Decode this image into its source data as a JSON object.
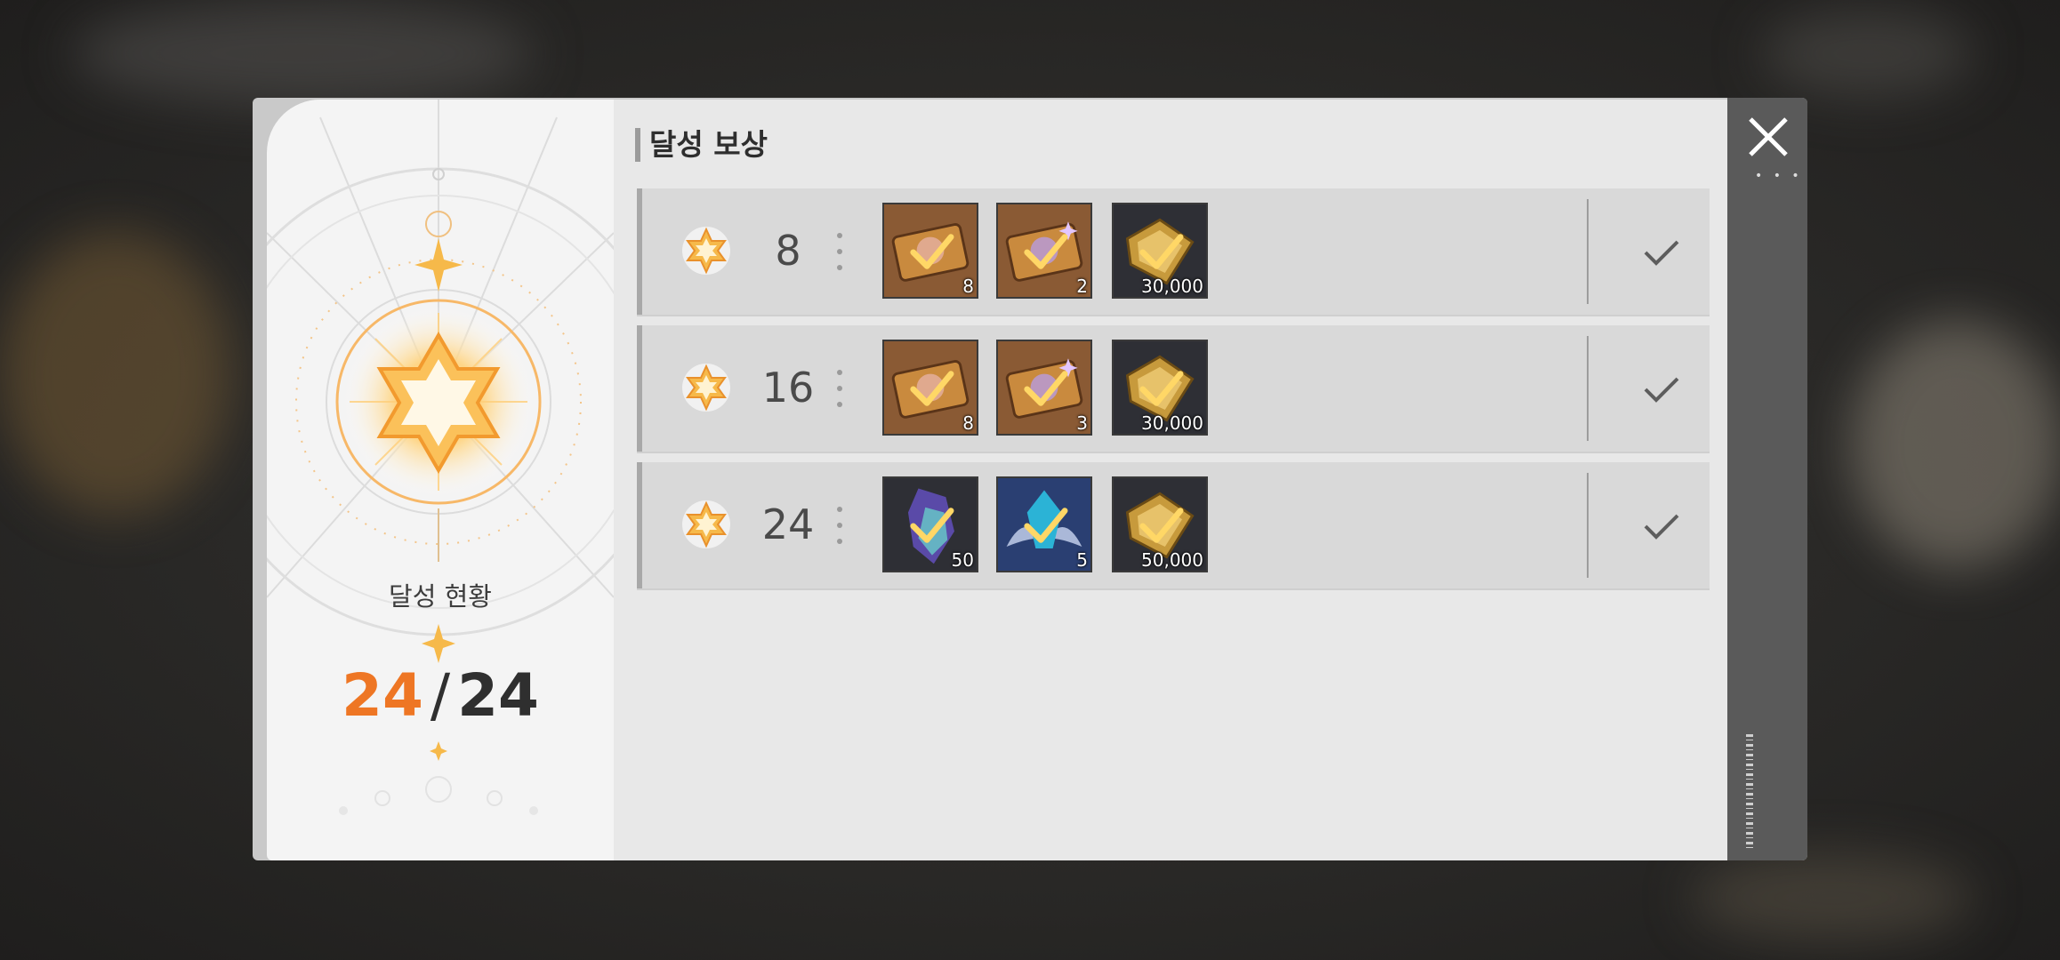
{
  "section_title": "달성 보상",
  "status": {
    "label": "달성 현황",
    "current": "24",
    "separator": "/",
    "total": "24"
  },
  "colors": {
    "accent": "#ee7624",
    "star": "#f6b94a",
    "check": "#ffd766"
  },
  "tiers": [
    {
      "requirement": "8",
      "claimed": true,
      "rewards": [
        {
          "icon": "ticket-bronze-icon",
          "qty": "8"
        },
        {
          "icon": "ticket-purple-spark-icon",
          "qty": "2"
        },
        {
          "icon": "gold-plate-icon",
          "qty": "30,000"
        }
      ]
    },
    {
      "requirement": "16",
      "claimed": true,
      "rewards": [
        {
          "icon": "ticket-bronze-icon",
          "qty": "8"
        },
        {
          "icon": "ticket-purple-spark-icon",
          "qty": "3"
        },
        {
          "icon": "gold-plate-icon",
          "qty": "30,000"
        }
      ]
    },
    {
      "requirement": "24",
      "claimed": true,
      "rewards": [
        {
          "icon": "prism-crystal-icon",
          "qty": "50"
        },
        {
          "icon": "winged-crystal-icon",
          "qty": "5"
        },
        {
          "icon": "gold-plate-icon",
          "qty": "50,000"
        }
      ]
    }
  ]
}
